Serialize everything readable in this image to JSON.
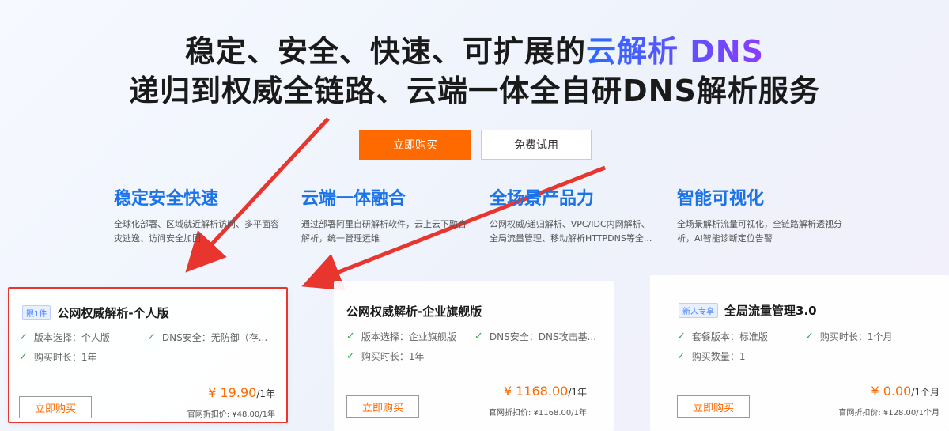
{
  "hero": {
    "line1_a": "稳定、安全、快速、可扩展的",
    "line1_b": "云解析 DNS",
    "line2": "递归到权威全链路、云端一体全自研DNS解析服务"
  },
  "buttons": {
    "buy": "立即购买",
    "trial": "免费试用"
  },
  "features": [
    {
      "title": "稳定安全快速",
      "desc": "全球化部署、区域就近解析访问、多平面容灾逃逸、访问安全加固"
    },
    {
      "title": "云端一体融合",
      "desc": "通过部署阿里自研解析软件，云上云下融合解析，统一管理运维"
    },
    {
      "title": "全场景产品力",
      "desc": "公网权威/递归解析、VPC/IDC内网解析、全局流量管理、移动解析HTTPDNS等全..."
    },
    {
      "title": "智能可视化",
      "desc": "全场景解析流量可视化，全链路解析透视分析，AI智能诊断定位告警"
    }
  ],
  "cards": [
    {
      "badge": "限1件",
      "title": "公网权威解析-个人版",
      "features": [
        "版本选择：个人版",
        "DNS安全：无防御（存...",
        "购买时长：1年"
      ],
      "price": "¥ 19.90",
      "unit": "/1年",
      "original": "官网折扣价: ¥48.00/1年",
      "button": "立即购买"
    },
    {
      "badge": "",
      "title": "公网权威解析-企业旗舰版",
      "features": [
        "版本选择：企业旗舰版",
        "DNS安全：DNS攻击基...",
        "购买时长：1年"
      ],
      "price": "¥ 1168.00",
      "unit": "/1年",
      "original": "官网折扣价: ¥1168.00/1年",
      "button": "立即购买"
    },
    {
      "badge": "新人专享",
      "title": "全局流量管理3.0",
      "features": [
        "套餐版本：标准版",
        "购买时长：1个月",
        "购买数量：1"
      ],
      "price": "¥ 0.00",
      "unit": "/1个月",
      "original": "官网折扣价: ¥128.00/1个月",
      "button": "立即购买"
    }
  ],
  "colors": {
    "accent": "#ff6a00",
    "blue": "#1a73e8",
    "highlight": "#e8352d",
    "check": "#2fa84f"
  }
}
